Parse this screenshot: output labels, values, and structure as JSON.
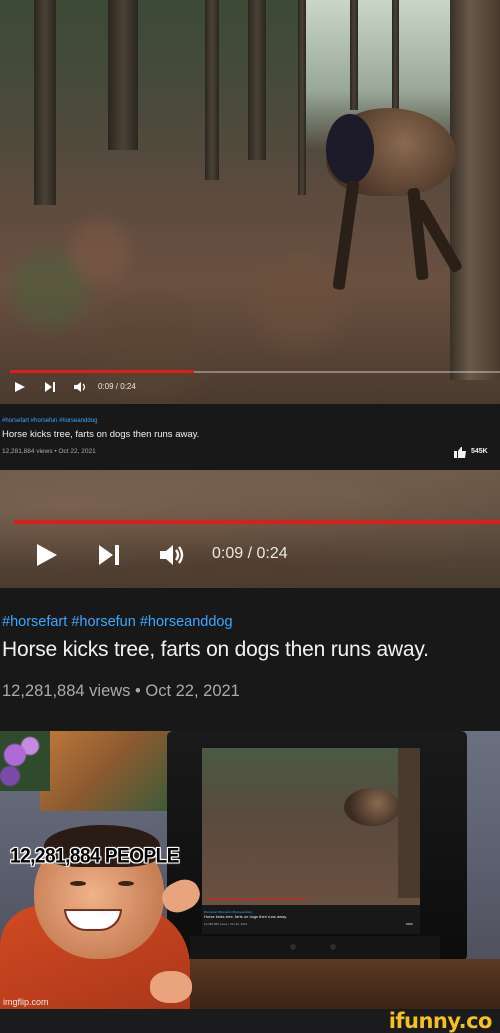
{
  "video": {
    "hashtags": "#horsefart #horsefun #horseanddog",
    "title": "Horse kicks tree, farts on dogs then runs away.",
    "meta": "12,281,884 views • Oct 22, 2021",
    "likes": "545K",
    "time": "0:09 / 0:24",
    "progress_fraction": 0.375
  },
  "meme": {
    "caption": "12,281,884 PEOPLE",
    "watermark": "imgflip.com"
  },
  "footer": {
    "brand": "ifunny.co"
  },
  "colors": {
    "progress_red": "#e01d1d",
    "hashtag_blue": "#3ea6ff",
    "ifunny_yellow": "#f4c21b"
  }
}
